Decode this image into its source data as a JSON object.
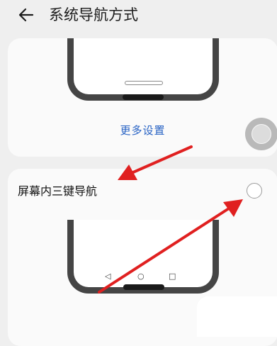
{
  "header": {
    "title": "系统导航方式",
    "back_icon": "arrow-left-icon"
  },
  "gesture_card": {
    "more_settings_label": "更多设置"
  },
  "three_key_card": {
    "label": "屏幕内三键导航",
    "selected": false,
    "nav_keys": {
      "back": "◁",
      "home": "○",
      "recent": "□"
    }
  },
  "colors": {
    "link": "#2762c4",
    "arrow": "#e02020",
    "phone_frame": "#454545"
  }
}
